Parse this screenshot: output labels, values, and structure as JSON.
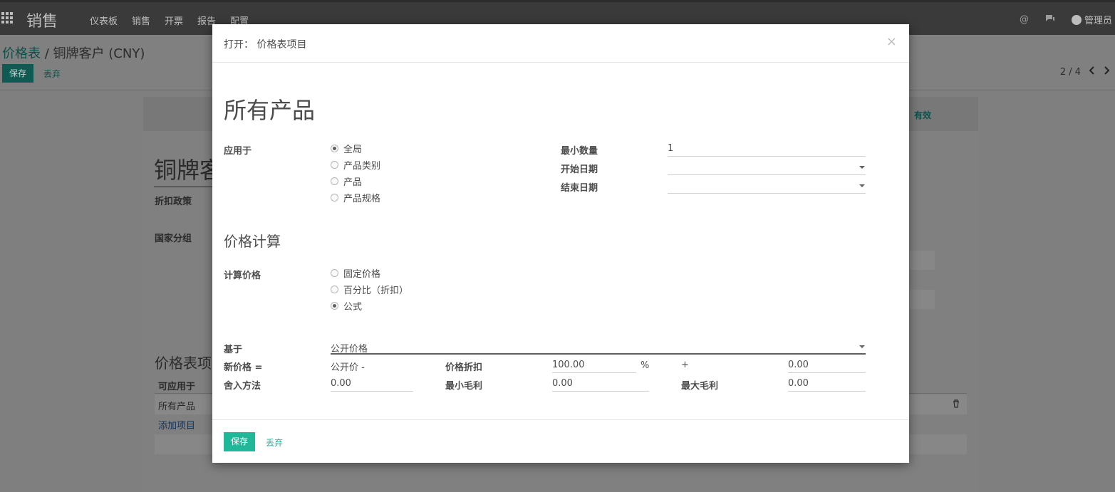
{
  "topbar": {
    "app_name": "销售",
    "menu": [
      "仪表板",
      "销售",
      "开票",
      "报告",
      "配置"
    ],
    "at_icon": "@",
    "chat_icon": "💬",
    "user": "管理员"
  },
  "breadcrumb": {
    "parent": "价格表",
    "separator": "/",
    "current": "铜牌客户 (CNY)"
  },
  "control_panel": {
    "save": "保存",
    "discard": "丢弃",
    "pager": "2 / 4"
  },
  "sheet": {
    "status": "有效",
    "title": "铜牌客户 (CNY)",
    "field_discount": "折扣政策",
    "field_country_group": "国家分组",
    "section_items": "价格表项目",
    "col_applicable": "可应用于",
    "row_value": "所有产品",
    "add_item": "添加项目"
  },
  "modal": {
    "header": "打开： 价格表项目",
    "close": "×",
    "title": "所有产品",
    "apply_on": {
      "label": "应用于",
      "options": [
        "全局",
        "产品类别",
        "产品",
        "产品规格"
      ],
      "selected": 0
    },
    "min_qty": {
      "label": "最小数量",
      "value": "1"
    },
    "start_date": {
      "label": "开始日期",
      "value": ""
    },
    "end_date": {
      "label": "结束日期",
      "value": ""
    },
    "section_price": "价格计算",
    "compute_price": {
      "label": "计算价格",
      "options": [
        "固定价格",
        "百分比（折扣）",
        "公式"
      ],
      "selected": 2
    },
    "based_on": {
      "label": "基于",
      "value": "公开价格"
    },
    "new_price": {
      "label": "新价格 =",
      "expr": "公开价 -"
    },
    "price_discount": {
      "label": "价格折扣",
      "value": "100.00",
      "unit": "%"
    },
    "plus": "+",
    "surcharge": {
      "value": "0.00"
    },
    "rounding": {
      "label": "舍入方法",
      "value": "0.00"
    },
    "min_margin": {
      "label": "最小毛利",
      "value": "0.00"
    },
    "max_margin": {
      "label": "最大毛利",
      "value": "0.00"
    },
    "footer": {
      "save": "保存",
      "discard": "丢弃"
    }
  }
}
